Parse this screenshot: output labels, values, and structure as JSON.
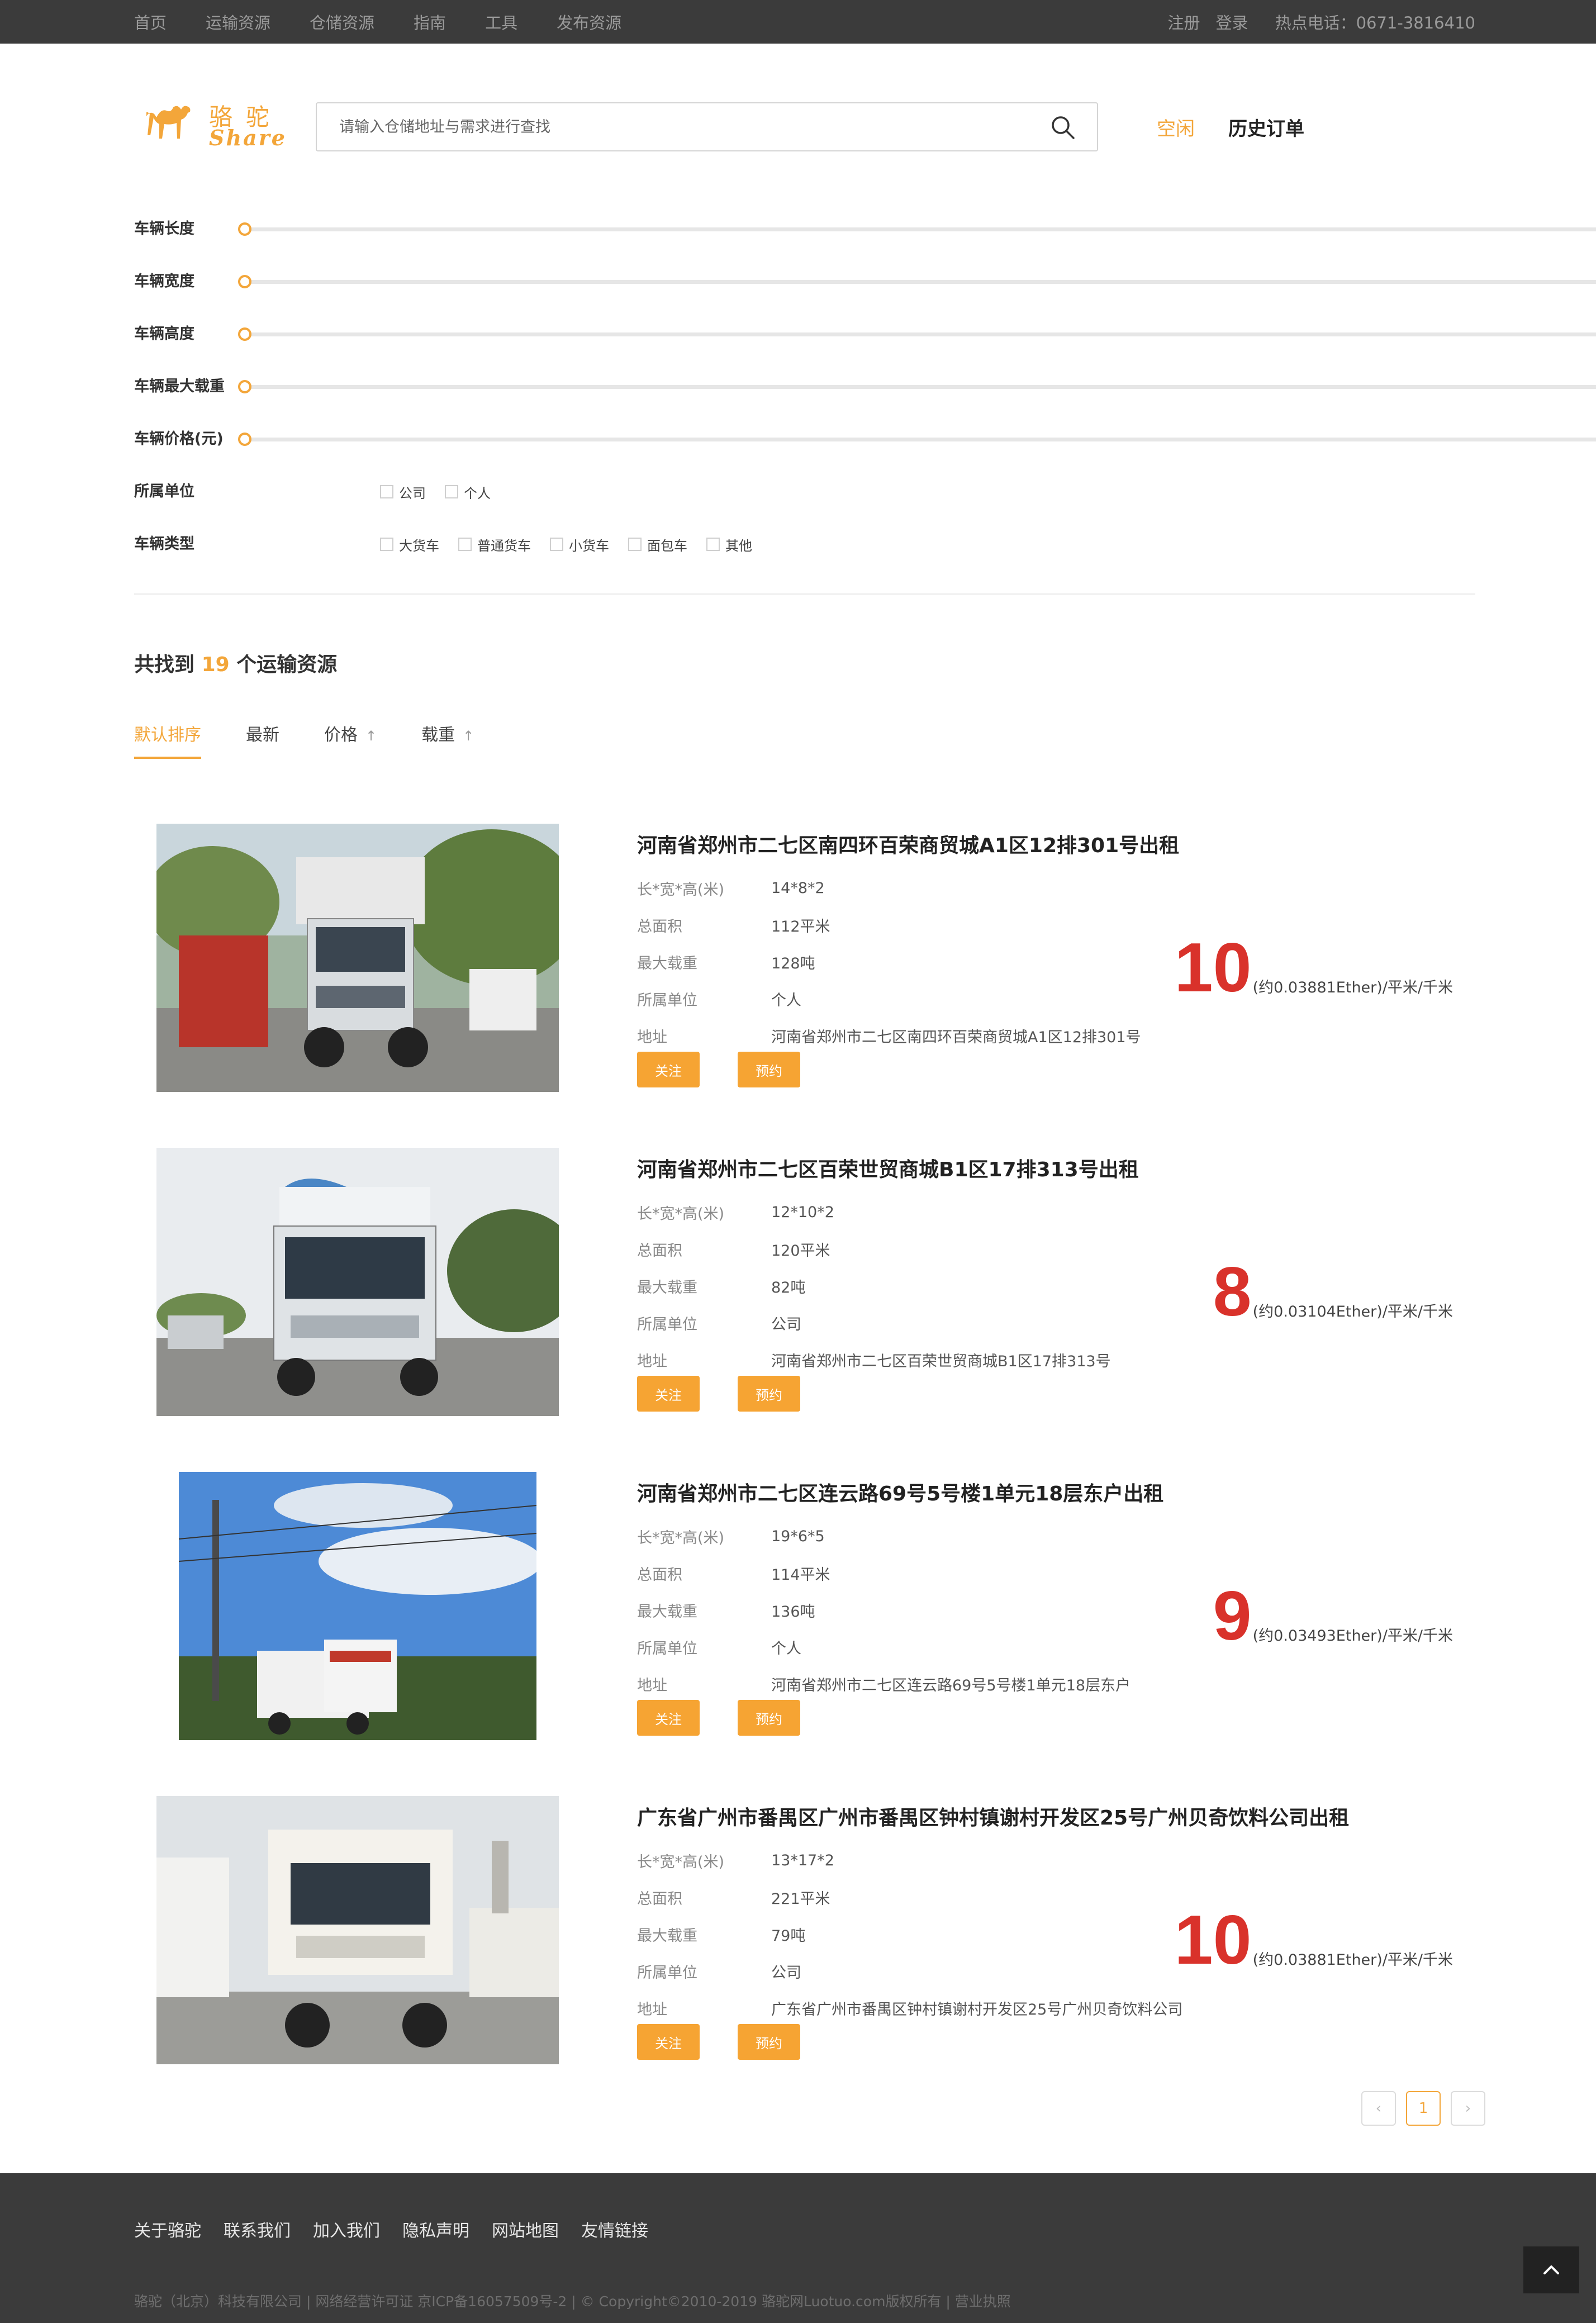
{
  "topnav": {
    "items": [
      "首页",
      "运输资源",
      "仓储资源",
      "指南",
      "工具",
      "发布资源"
    ],
    "register": "注册",
    "login": "登录",
    "hotline": "热点电话：0671-3816410"
  },
  "logo": {
    "cn": "骆驼",
    "en": "Share"
  },
  "search": {
    "placeholder": "请输入仓储地址与需求进行查找"
  },
  "header_links": {
    "idle": "空闲",
    "history": "历史订单"
  },
  "filters": {
    "sliders": [
      "车辆长度",
      "车辆宽度",
      "车辆高度",
      "车辆最大载重",
      "车辆价格(元)"
    ],
    "owner_label": "所属单位",
    "owner_options": [
      "公司",
      "个人"
    ],
    "type_label": "车辆类型",
    "type_options": [
      "大货车",
      "普通货车",
      "小货车",
      "面包车",
      "其他"
    ]
  },
  "results": {
    "prefix": "共找到",
    "count": "19",
    "suffix": "个运输资源"
  },
  "sort": {
    "items": [
      "默认排序",
      "最新",
      "价格",
      "载重"
    ],
    "arrow": "↑"
  },
  "spec_labels": {
    "dims": "长*宽*高(米)",
    "area": "总面积",
    "max_load": "最大载重",
    "owner": "所属单位",
    "address": "地址"
  },
  "buttons": {
    "follow": "关注",
    "reserve": "预约"
  },
  "listings": [
    {
      "title": "河南省郑州市二七区南四环百荣商贸城A1区12排301号出租",
      "dims": "14*8*2",
      "area": "112平米",
      "max_load": "128吨",
      "owner": "个人",
      "address": "河南省郑州市二七区南四环百荣商贸城A1区12排301号",
      "price": "10",
      "price_note": "(约0.03881Ether)/平米/千米"
    },
    {
      "title": "河南省郑州市二七区百荣世贸商城B1区17排313号出租",
      "dims": "12*10*2",
      "area": "120平米",
      "max_load": "82吨",
      "owner": "公司",
      "address": "河南省郑州市二七区百荣世贸商城B1区17排313号",
      "price": "8",
      "price_note": "(约0.03104Ether)/平米/千米"
    },
    {
      "title": "河南省郑州市二七区连云路69号5号楼1单元18层东户出租",
      "dims": "19*6*5",
      "area": "114平米",
      "max_load": "136吨",
      "owner": "个人",
      "address": "河南省郑州市二七区连云路69号5号楼1单元18层东户",
      "price": "9",
      "price_note": "(约0.03493Ether)/平米/千米"
    },
    {
      "title": "广东省广州市番禺区广州市番禺区钟村镇谢村开发区25号广州贝奇饮料公司出租",
      "dims": "13*17*2",
      "area": "221平米",
      "max_load": "79吨",
      "owner": "公司",
      "address": "广东省广州市番禺区钟村镇谢村开发区25号广州贝奇饮料公司",
      "price": "10",
      "price_note": "(约0.03881Ether)/平米/千米"
    }
  ],
  "pagination": {
    "prev": "‹",
    "current": "1",
    "next": "›"
  },
  "footer": {
    "links": [
      "关于骆驼",
      "联系我们",
      "加入我们",
      "隐私声明",
      "网站地图",
      "友情链接"
    ],
    "copyright": "骆驼（北京）科技有限公司 | 网络经营许可证 京ICP备16057509号-2 | © Copyright©2010-2019 骆驼网Luotuo.com版权所有 | 营业执照"
  },
  "colors": {
    "accent": "#f3a63a",
    "price": "#d9322b",
    "bar": "#3b3b3b"
  }
}
